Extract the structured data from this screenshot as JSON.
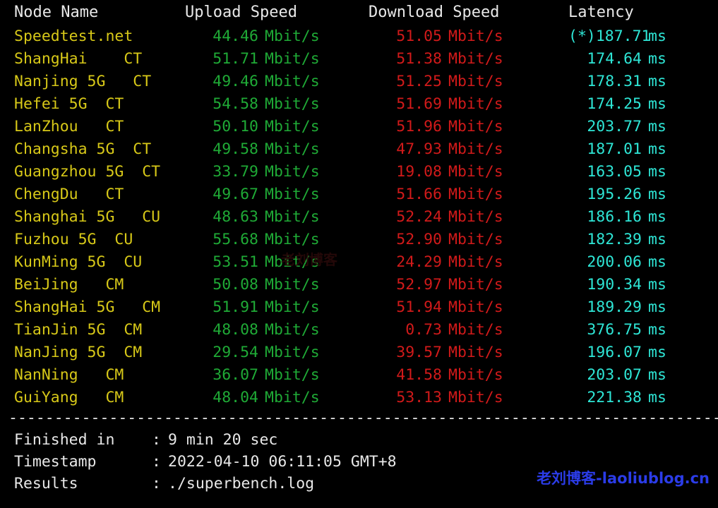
{
  "terminal": {
    "background": "#000000",
    "colors": {
      "header": "#e8e8e8",
      "node": "#d7c818",
      "upload": "#1faa36",
      "download": "#d11a1a",
      "latency": "#2ee6d6",
      "watermark": "#2b3ce8"
    }
  },
  "table": {
    "headers": {
      "node": "Node Name",
      "upload": "Upload Speed",
      "download": "Download Speed",
      "latency": "Latency"
    },
    "unit_speed": "Mbit/s",
    "unit_latency": "ms",
    "rows": [
      {
        "node": "Speedtest.net",
        "upload": "44.46",
        "download": "51.05",
        "latency": "(*)187.71"
      },
      {
        "node": "ShangHai    CT",
        "upload": "51.71",
        "download": "51.38",
        "latency": "174.64"
      },
      {
        "node": "Nanjing 5G   CT",
        "upload": "49.46",
        "download": "51.25",
        "latency": "178.31"
      },
      {
        "node": "Hefei 5G  CT",
        "upload": "54.58",
        "download": "51.69",
        "latency": "174.25"
      },
      {
        "node": "LanZhou   CT",
        "upload": "50.10",
        "download": "51.96",
        "latency": "203.77"
      },
      {
        "node": "Changsha 5G  CT",
        "upload": "49.58",
        "download": "47.93",
        "latency": "187.01"
      },
      {
        "node": "Guangzhou 5G  CT",
        "upload": "33.79",
        "download": "19.08",
        "latency": "163.05"
      },
      {
        "node": "ChengDu   CT",
        "upload": "49.67",
        "download": "51.66",
        "latency": "195.26"
      },
      {
        "node": "Shanghai 5G   CU",
        "upload": "48.63",
        "download": "52.24",
        "latency": "186.16"
      },
      {
        "node": "Fuzhou 5G  CU",
        "upload": "55.68",
        "download": "52.90",
        "latency": "182.39"
      },
      {
        "node": "KunMing 5G  CU",
        "upload": "53.51",
        "download": "24.29",
        "latency": "200.06"
      },
      {
        "node": "BeiJing   CM",
        "upload": "50.08",
        "download": "52.97",
        "latency": "190.34"
      },
      {
        "node": "ShangHai 5G   CM",
        "upload": "51.91",
        "download": "51.94",
        "latency": "189.29"
      },
      {
        "node": "TianJin 5G  CM",
        "upload": "48.08",
        "download": "0.73",
        "latency": "376.75"
      },
      {
        "node": "NanJing 5G  CM",
        "upload": "29.54",
        "download": "39.57",
        "latency": "196.07"
      },
      {
        "node": "NanNing   CM",
        "upload": "36.07",
        "download": "41.58",
        "latency": "203.07"
      },
      {
        "node": "GuiYang   CM",
        "upload": "48.04",
        "download": "53.13",
        "latency": "221.38"
      }
    ]
  },
  "separator": "----------------------------------------------------------------------------------",
  "footer": {
    "rows": [
      {
        "label": "Finished in",
        "colon": ":",
        "value": "9 min 20 sec"
      },
      {
        "label": "Timestamp",
        "colon": ":",
        "value": "2022-04-10 06:11:05 GMT+8"
      },
      {
        "label": "Results",
        "colon": ":",
        "value": "./superbench.log"
      }
    ]
  },
  "watermark": {
    "main": "老刘博客-laoliublog.cn",
    "ghost": "老刘博客"
  }
}
